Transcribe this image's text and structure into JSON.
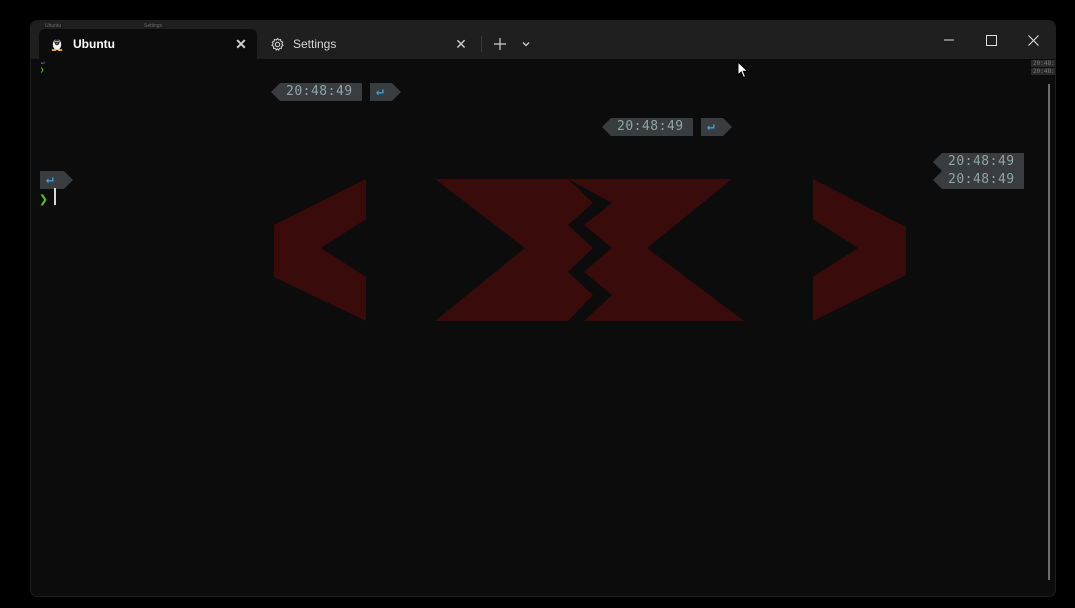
{
  "window": {
    "tabs": [
      {
        "label": "Ubuntu",
        "icon": "linux-penguin-icon",
        "active": true,
        "close": "✕"
      },
      {
        "label": "Settings",
        "icon": "gear-icon",
        "active": false,
        "close": "✕"
      }
    ],
    "new_tab": "+",
    "dropdown": "⌄",
    "controls": {
      "minimize": "—",
      "maximize": "☐",
      "close": "✕"
    }
  },
  "terminal": {
    "prompt_lines": [
      {
        "time": "20:48:49",
        "status": "↵"
      },
      {
        "time": "20:48:49",
        "status": "↵"
      }
    ],
    "right_times": [
      "20:48:49",
      "20:48:49"
    ],
    "return_badge": "↵",
    "prompt_char": "❯"
  },
  "colors": {
    "background": "#0c0c0c",
    "segment": "#3a3d3f",
    "time_text": "#8fa3a8",
    "return_text": "#3aa0d8",
    "prompt_green": "#57c21a",
    "art_red": "#3a0b0b"
  }
}
